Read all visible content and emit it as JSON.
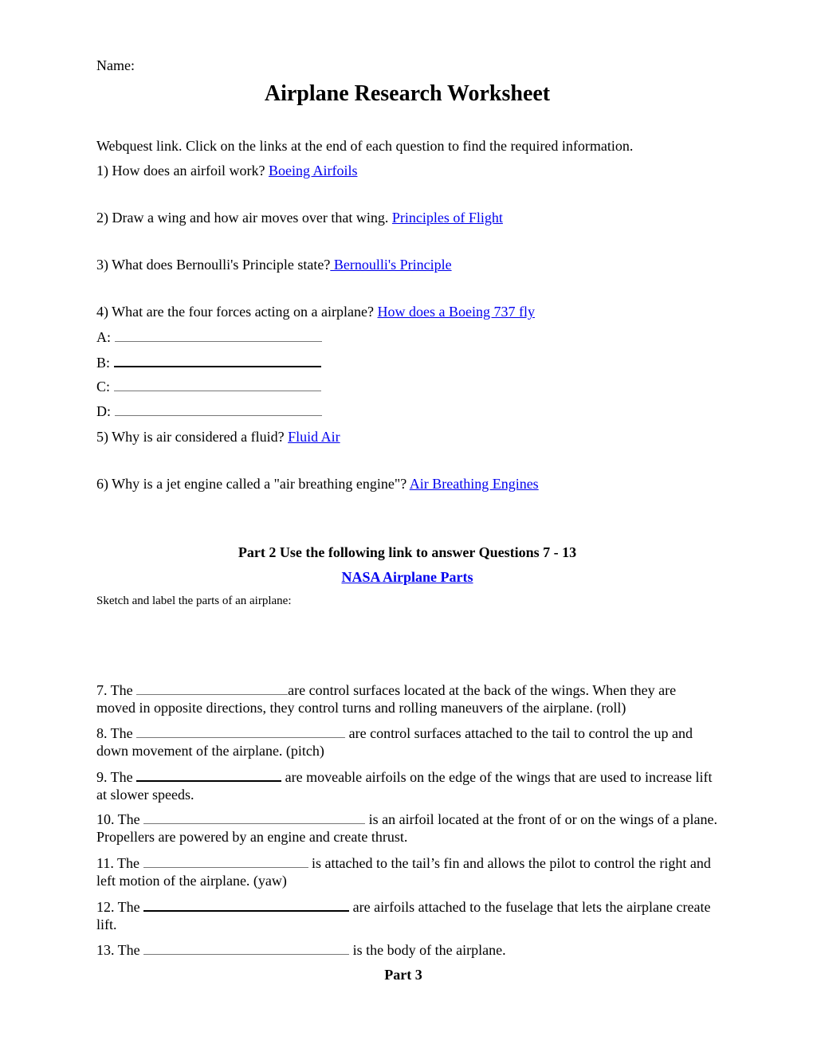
{
  "header": {
    "name_label": "Name:",
    "title": "Airplane Research Worksheet"
  },
  "intro": "Webquest link.  Click on the links at the end of each question to find the required information.",
  "part1": {
    "questions": [
      {
        "text": "1) How does an airfoil work? ",
        "link": "Boeing Airfoils"
      },
      {
        "text": "2) Draw a wing and how air moves over that wing. ",
        "link": "Principles of Flight"
      },
      {
        "text": "3) What does Bernoulli's Principle state?",
        "link": " Bernoulli's Principle"
      },
      {
        "text": "4) What are the four forces acting on a airplane? ",
        "link": "How does a Boeing 737 fly"
      },
      {
        "text": "5) Why is air considered a fluid? ",
        "link": "Fluid Air"
      },
      {
        "text": "6) Why is a jet engine called a \"air breathing engine\"? ",
        "link": "Air Breathing Engines"
      }
    ],
    "forces": [
      "A:",
      "B:",
      "C:",
      "D:"
    ]
  },
  "part2": {
    "heading": "Part 2 Use the following link to answer Questions 7 - 13",
    "link": "NASA Airplane Parts",
    "sketch_prompt": "Sketch and label the parts of an airplane:",
    "questions": [
      {
        "num": "7. The ",
        "rest": "are control surfaces located at the back of the wings. When they are moved in opposite directions, they control turns and rolling maneuvers of the airplane. (roll)"
      },
      {
        "num": "8. The ",
        "rest": " are control surfaces attached to the tail to control the up and down movement of the airplane. (pitch)"
      },
      {
        "num": "9. The ",
        "rest": " are moveable airfoils on the edge of the wings that are used to increase lift at slower speeds."
      },
      {
        "num": "10. The ",
        "rest": " is an airfoil located at the front of or on the wings of a plane. Propellers are powered by an engine and create thrust."
      },
      {
        "num": "11. The ",
        "rest": " is attached to the tail’s fin and allows the pilot to control the right and left motion of the airplane. (yaw)"
      },
      {
        "num": "12. The ",
        "rest": " are airfoils attached to the fuselage that lets the airplane create lift."
      },
      {
        "num": "13. The ",
        "rest": " is the body of the airplane."
      }
    ]
  },
  "part3": {
    "heading": "Part 3"
  }
}
